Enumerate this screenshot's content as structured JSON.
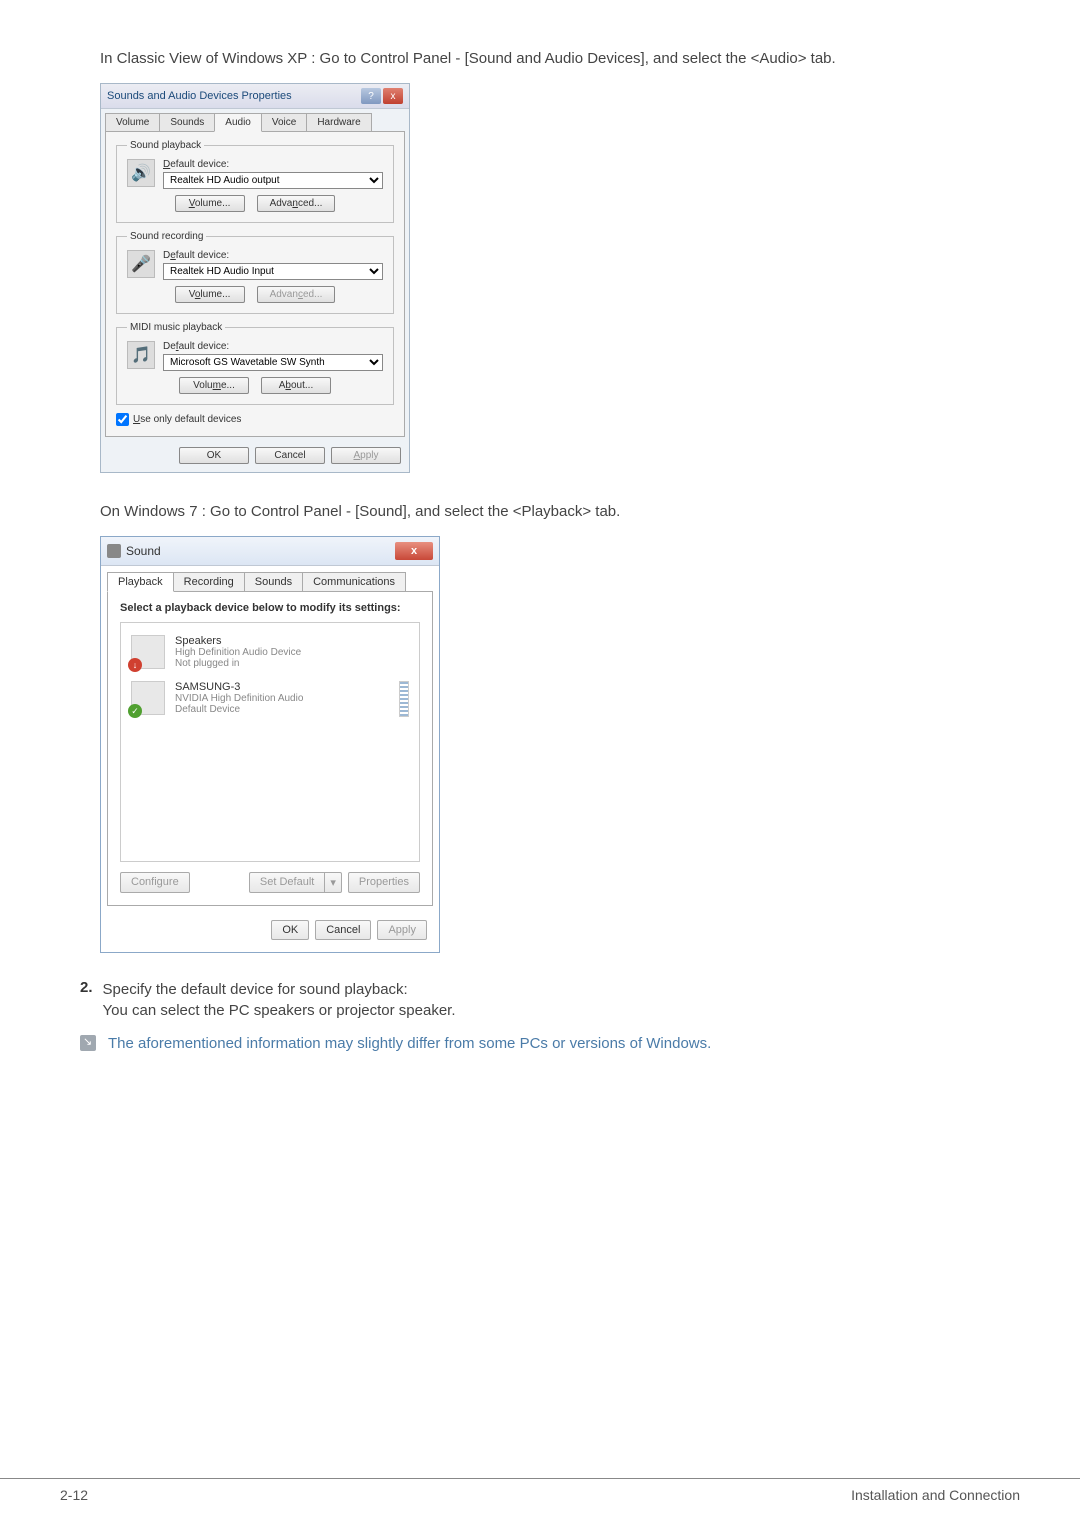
{
  "text": {
    "instruction_xp": "In Classic View of Windows XP : Go to Control Panel - [Sound and Audio Devices], and select the <Audio> tab.",
    "instruction_w7": "On Windows 7 : Go to Control Panel - [Sound], and select the <Playback> tab.",
    "step_num": "2.",
    "step_line1": "Specify the default device for sound playback:",
    "step_line2": "You can select the PC speakers or projector speaker.",
    "note": "The aforementioned information may slightly differ from some PCs or versions of Windows."
  },
  "dialog_xp": {
    "title": "Sounds and Audio Devices Properties",
    "tabs": [
      "Volume",
      "Sounds",
      "Audio",
      "Voice",
      "Hardware"
    ],
    "playback": {
      "legend": "Sound playback",
      "label": "Default device:",
      "device": "Realtek HD Audio output",
      "btn_volume": "Volume...",
      "btn_advanced": "Advanced..."
    },
    "recording": {
      "legend": "Sound recording",
      "label": "Default device:",
      "device": "Realtek HD Audio Input",
      "btn_volume": "Volume...",
      "btn_advanced": "Advanced..."
    },
    "midi": {
      "legend": "MIDI music playback",
      "label": "Default device:",
      "device": "Microsoft GS Wavetable SW Synth",
      "btn_volume": "Volume...",
      "btn_about": "About..."
    },
    "checkbox": "Use only default devices",
    "btn_ok": "OK",
    "btn_cancel": "Cancel",
    "btn_apply": "Apply"
  },
  "dialog_w7": {
    "title": "Sound",
    "tabs": [
      "Playback",
      "Recording",
      "Sounds",
      "Communications"
    ],
    "select_text": "Select a playback device below to modify its settings:",
    "dev1": {
      "name": "Speakers",
      "desc": "High Definition Audio Device",
      "status": "Not plugged in"
    },
    "dev2": {
      "name": "SAMSUNG-3",
      "desc": "NVIDIA High Definition Audio",
      "status": "Default Device"
    },
    "btn_configure": "Configure",
    "btn_setdefault": "Set Default",
    "btn_properties": "Properties",
    "btn_ok": "OK",
    "btn_cancel": "Cancel",
    "btn_apply": "Apply"
  },
  "footer": {
    "left": "2-12",
    "right": "Installation and Connection"
  }
}
